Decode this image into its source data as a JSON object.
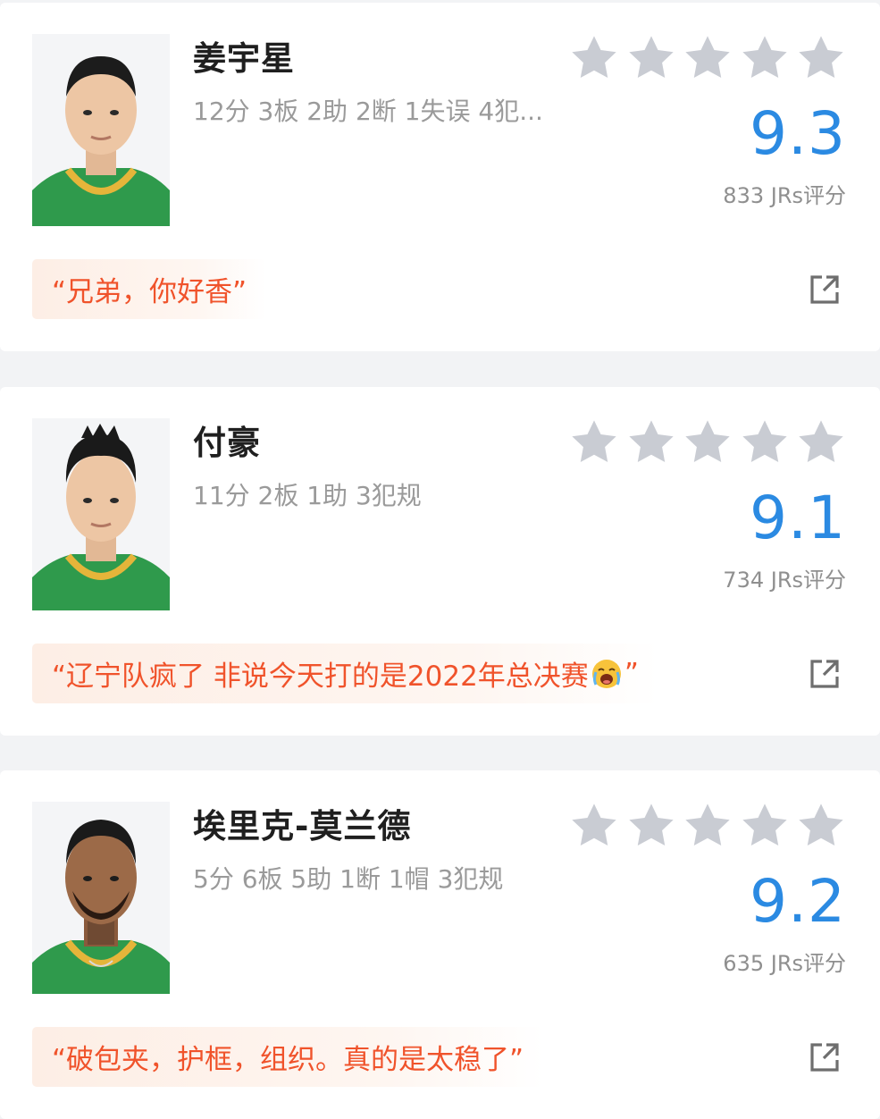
{
  "colors": {
    "accent": "#2b8ae2",
    "quote_text": "#f0532b",
    "star": "#c9ccd3",
    "background": "#f2f3f5"
  },
  "players": [
    {
      "name": "姜宇星",
      "stats": "12分 3板 2助 2断 1失误 4犯...",
      "rating_stars": 0,
      "score": "9.3",
      "rating_count": "833 JRs评分",
      "quote": "“兄弟，你好香”",
      "share_icon": "share-external-icon"
    },
    {
      "name": "付豪",
      "stats": "11分 2板 1助 3犯规",
      "rating_stars": 0,
      "score": "9.1",
      "rating_count": "734 JRs评分",
      "quote": "“辽宁队疯了 非说今天打的是2022年总决赛",
      "quote_end": "”",
      "quote_emoji": "crying-face-icon",
      "share_icon": "share-external-icon"
    },
    {
      "name": "埃里克-莫兰德",
      "stats": "5分 6板 5助 1断 1帽 3犯规",
      "rating_stars": 0,
      "score": "9.2",
      "rating_count": "635 JRs评分",
      "quote": "“破包夹，护框，组织。真的是太稳了”",
      "share_icon": "share-external-icon"
    }
  ]
}
